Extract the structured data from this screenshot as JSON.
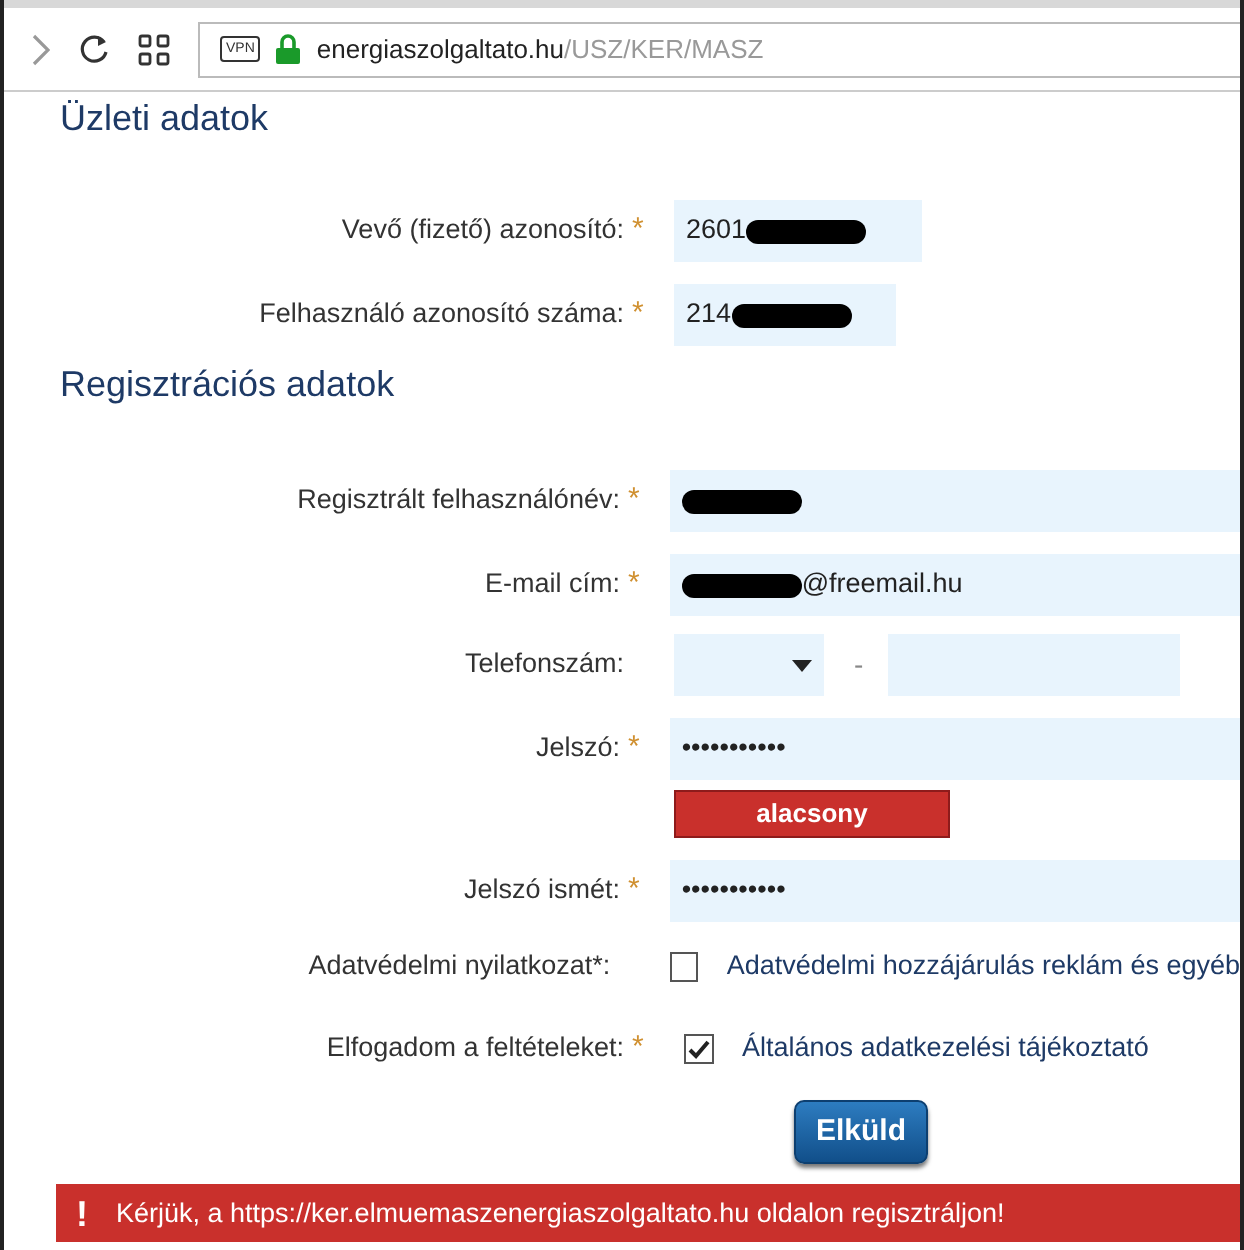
{
  "browser": {
    "url_host": "energiaszolgaltato.hu",
    "url_path": "/USZ/KER/MASZ",
    "vpn": "VPN"
  },
  "business": {
    "title": "Üzleti adatok",
    "fields": [
      {
        "kind": "short",
        "label": "Vevő (fizető) azonosító:",
        "required_mark": "*",
        "value": "2601",
        "redacted_suffix": true
      },
      {
        "kind": "shorter",
        "label": "Felhasználó azonosító száma:",
        "required_mark": "*",
        "value": "214",
        "redacted_suffix": true
      }
    ]
  },
  "registration": {
    "title": "Regisztrációs adatok",
    "fields": [
      {
        "kind": "wide",
        "label": "Regisztrált felhasználónév:",
        "required_mark": "*",
        "redacted_prefix": true
      },
      {
        "kind": "wide",
        "label": "E-mail cím:",
        "required_mark": "*",
        "value": "@freemail.hu",
        "redacted_prefix": true
      },
      {
        "kind": "phone",
        "label": "Telefonszám:",
        "separator": "-"
      },
      {
        "kind": "wide",
        "label": "Jelszó:",
        "required_mark": "*",
        "value": "•••••••••••"
      },
      {
        "kind": "strength",
        "text": "alacsony"
      },
      {
        "kind": "wide",
        "label": "Jelszó ismét:",
        "required_mark": "*",
        "value": "•••••••••••"
      },
      {
        "kind": "checkbox",
        "label": "Adatvédelmi nyilatkozat*:",
        "checked": false,
        "text": "Adatvédelmi hozzájárulás reklám és egyéb"
      },
      {
        "kind": "checkbox",
        "label": "Elfogadom a feltételeket:",
        "required_mark": "*",
        "checked": true,
        "text": "Általános adatkezelési tájékoztató"
      }
    ]
  },
  "submit": "Elküld",
  "alert": {
    "icon": "!",
    "text": "Kérjük, a https://ker.elmuemaszenergiaszolgaltato.hu oldalon regisztráljon!"
  }
}
